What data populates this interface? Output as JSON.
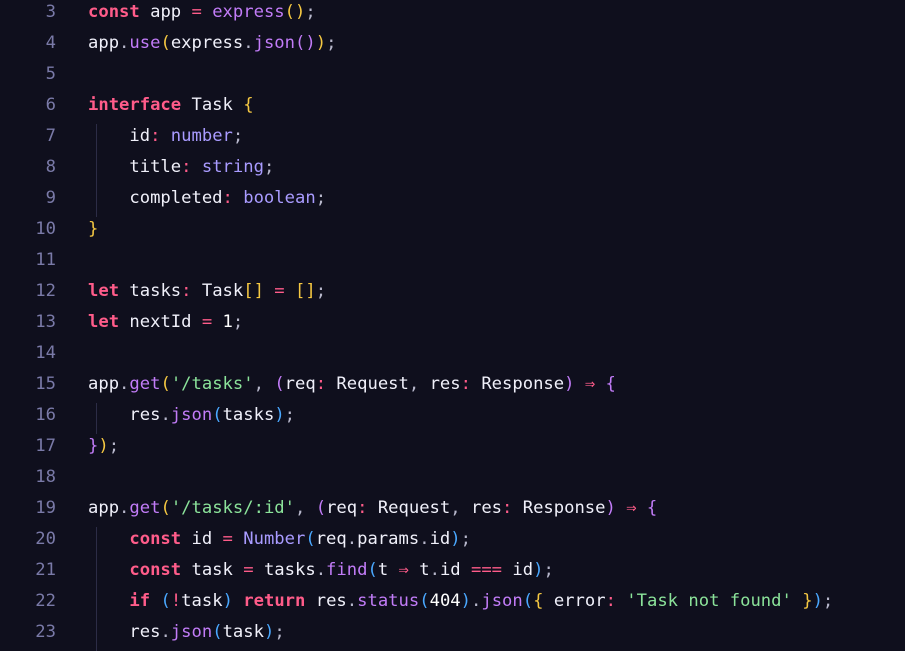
{
  "editor": {
    "language": "typescript",
    "theme_colors": {
      "background": "#0f0f1d",
      "line_number": "#7a7aa8",
      "keyword": "#ff5c8a",
      "function": "#c27cf8",
      "type": "#a99bff",
      "string": "#8be39a",
      "bracket_level1": "#f5c842",
      "bracket_level2": "#c27cf8",
      "bracket_level3": "#4aa8ff"
    },
    "lines": [
      {
        "number": "3",
        "tokens": [
          [
            "kw",
            "const"
          ],
          [
            "id",
            " app "
          ],
          [
            "op",
            "="
          ],
          [
            "fn",
            " express"
          ],
          [
            "brk1",
            "()"
          ],
          [
            "pun",
            ";"
          ]
        ]
      },
      {
        "number": "4",
        "tokens": [
          [
            "id",
            "app"
          ],
          [
            "pun",
            "."
          ],
          [
            "fn",
            "use"
          ],
          [
            "brk1",
            "("
          ],
          [
            "id",
            "express"
          ],
          [
            "pun",
            "."
          ],
          [
            "fn",
            "json"
          ],
          [
            "brk2",
            "()"
          ],
          [
            "brk1",
            ")"
          ],
          [
            "pun",
            ";"
          ]
        ]
      },
      {
        "number": "5",
        "tokens": []
      },
      {
        "number": "6",
        "tokens": [
          [
            "kw",
            "interface"
          ],
          [
            "cls",
            " Task "
          ],
          [
            "brk1",
            "{"
          ]
        ]
      },
      {
        "number": "7",
        "tokens": [
          [
            "id",
            "    id"
          ],
          [
            "op",
            ":"
          ],
          [
            "ty",
            " number"
          ],
          [
            "pun",
            ";"
          ]
        ]
      },
      {
        "number": "8",
        "tokens": [
          [
            "id",
            "    title"
          ],
          [
            "op",
            ":"
          ],
          [
            "ty",
            " string"
          ],
          [
            "pun",
            ";"
          ]
        ]
      },
      {
        "number": "9",
        "tokens": [
          [
            "id",
            "    completed"
          ],
          [
            "op",
            ":"
          ],
          [
            "ty",
            " boolean"
          ],
          [
            "pun",
            ";"
          ]
        ]
      },
      {
        "number": "10",
        "tokens": [
          [
            "brk1",
            "}"
          ]
        ]
      },
      {
        "number": "11",
        "tokens": []
      },
      {
        "number": "12",
        "tokens": [
          [
            "kw",
            "let"
          ],
          [
            "id",
            " tasks"
          ],
          [
            "op",
            ":"
          ],
          [
            "cls",
            " Task"
          ],
          [
            "brk1",
            "[]"
          ],
          [
            "op",
            " = "
          ],
          [
            "brk1",
            "[]"
          ],
          [
            "pun",
            ";"
          ]
        ]
      },
      {
        "number": "13",
        "tokens": [
          [
            "kw",
            "let"
          ],
          [
            "id",
            " nextId "
          ],
          [
            "op",
            "="
          ],
          [
            "num",
            " 1"
          ],
          [
            "pun",
            ";"
          ]
        ]
      },
      {
        "number": "14",
        "tokens": []
      },
      {
        "number": "15",
        "tokens": [
          [
            "id",
            "app"
          ],
          [
            "pun",
            "."
          ],
          [
            "fn",
            "get"
          ],
          [
            "brk1",
            "("
          ],
          [
            "str",
            "'/tasks'"
          ],
          [
            "pun",
            ", "
          ],
          [
            "brk2",
            "("
          ],
          [
            "id",
            "req"
          ],
          [
            "op",
            ":"
          ],
          [
            "cls",
            " Request"
          ],
          [
            "pun",
            ", "
          ],
          [
            "id",
            "res"
          ],
          [
            "op",
            ":"
          ],
          [
            "cls",
            " Response"
          ],
          [
            "brk2",
            ")"
          ],
          [
            "op",
            " ⇒ "
          ],
          [
            "brk2",
            "{"
          ]
        ]
      },
      {
        "number": "16",
        "tokens": [
          [
            "id",
            "    res"
          ],
          [
            "pun",
            "."
          ],
          [
            "fn",
            "json"
          ],
          [
            "brk3",
            "("
          ],
          [
            "id",
            "tasks"
          ],
          [
            "brk3",
            ")"
          ],
          [
            "pun",
            ";"
          ]
        ]
      },
      {
        "number": "17",
        "tokens": [
          [
            "brk2",
            "}"
          ],
          [
            "brk1",
            ")"
          ],
          [
            "pun",
            ";"
          ]
        ]
      },
      {
        "number": "18",
        "tokens": []
      },
      {
        "number": "19",
        "tokens": [
          [
            "id",
            "app"
          ],
          [
            "pun",
            "."
          ],
          [
            "fn",
            "get"
          ],
          [
            "brk1",
            "("
          ],
          [
            "str",
            "'/tasks/:id'"
          ],
          [
            "pun",
            ", "
          ],
          [
            "brk2",
            "("
          ],
          [
            "id",
            "req"
          ],
          [
            "op",
            ":"
          ],
          [
            "cls",
            " Request"
          ],
          [
            "pun",
            ", "
          ],
          [
            "id",
            "res"
          ],
          [
            "op",
            ":"
          ],
          [
            "cls",
            " Response"
          ],
          [
            "brk2",
            ")"
          ],
          [
            "op",
            " ⇒ "
          ],
          [
            "brk2",
            "{"
          ]
        ]
      },
      {
        "number": "20",
        "tokens": [
          [
            "kw",
            "    const"
          ],
          [
            "id",
            " id "
          ],
          [
            "op",
            "="
          ],
          [
            "ty",
            " Number"
          ],
          [
            "brk3",
            "("
          ],
          [
            "id",
            "req"
          ],
          [
            "pun",
            "."
          ],
          [
            "id",
            "params"
          ],
          [
            "pun",
            "."
          ],
          [
            "id",
            "id"
          ],
          [
            "brk3",
            ")"
          ],
          [
            "pun",
            ";"
          ]
        ]
      },
      {
        "number": "21",
        "tokens": [
          [
            "kw",
            "    const"
          ],
          [
            "id",
            " task "
          ],
          [
            "op",
            "="
          ],
          [
            "id",
            " tasks"
          ],
          [
            "pun",
            "."
          ],
          [
            "fn",
            "find"
          ],
          [
            "brk3",
            "("
          ],
          [
            "id",
            "t "
          ],
          [
            "op",
            "⇒"
          ],
          [
            "id",
            " t"
          ],
          [
            "pun",
            "."
          ],
          [
            "id",
            "id "
          ],
          [
            "op",
            "==="
          ],
          [
            "id",
            " id"
          ],
          [
            "brk3",
            ")"
          ],
          [
            "pun",
            ";"
          ]
        ]
      },
      {
        "number": "22",
        "tokens": [
          [
            "kw",
            "    if"
          ],
          [
            "pun",
            " "
          ],
          [
            "brk3",
            "("
          ],
          [
            "op",
            "!"
          ],
          [
            "id",
            "task"
          ],
          [
            "brk3",
            ")"
          ],
          [
            "kw",
            " return"
          ],
          [
            "id",
            " res"
          ],
          [
            "pun",
            "."
          ],
          [
            "fn",
            "status"
          ],
          [
            "brk3",
            "("
          ],
          [
            "num",
            "404"
          ],
          [
            "brk3",
            ")"
          ],
          [
            "pun",
            "."
          ],
          [
            "fn",
            "json"
          ],
          [
            "brk3",
            "("
          ],
          [
            "brk1",
            "{"
          ],
          [
            "id",
            " error"
          ],
          [
            "op",
            ":"
          ],
          [
            "str",
            " 'Task not found'"
          ],
          [
            "brk1",
            " }"
          ],
          [
            "brk3",
            ")"
          ],
          [
            "pun",
            ";"
          ]
        ]
      },
      {
        "number": "23",
        "tokens": [
          [
            "id",
            "    res"
          ],
          [
            "pun",
            "."
          ],
          [
            "fn",
            "json"
          ],
          [
            "brk3",
            "("
          ],
          [
            "id",
            "task"
          ],
          [
            "brk3",
            ")"
          ],
          [
            "pun",
            ";"
          ]
        ]
      }
    ]
  }
}
